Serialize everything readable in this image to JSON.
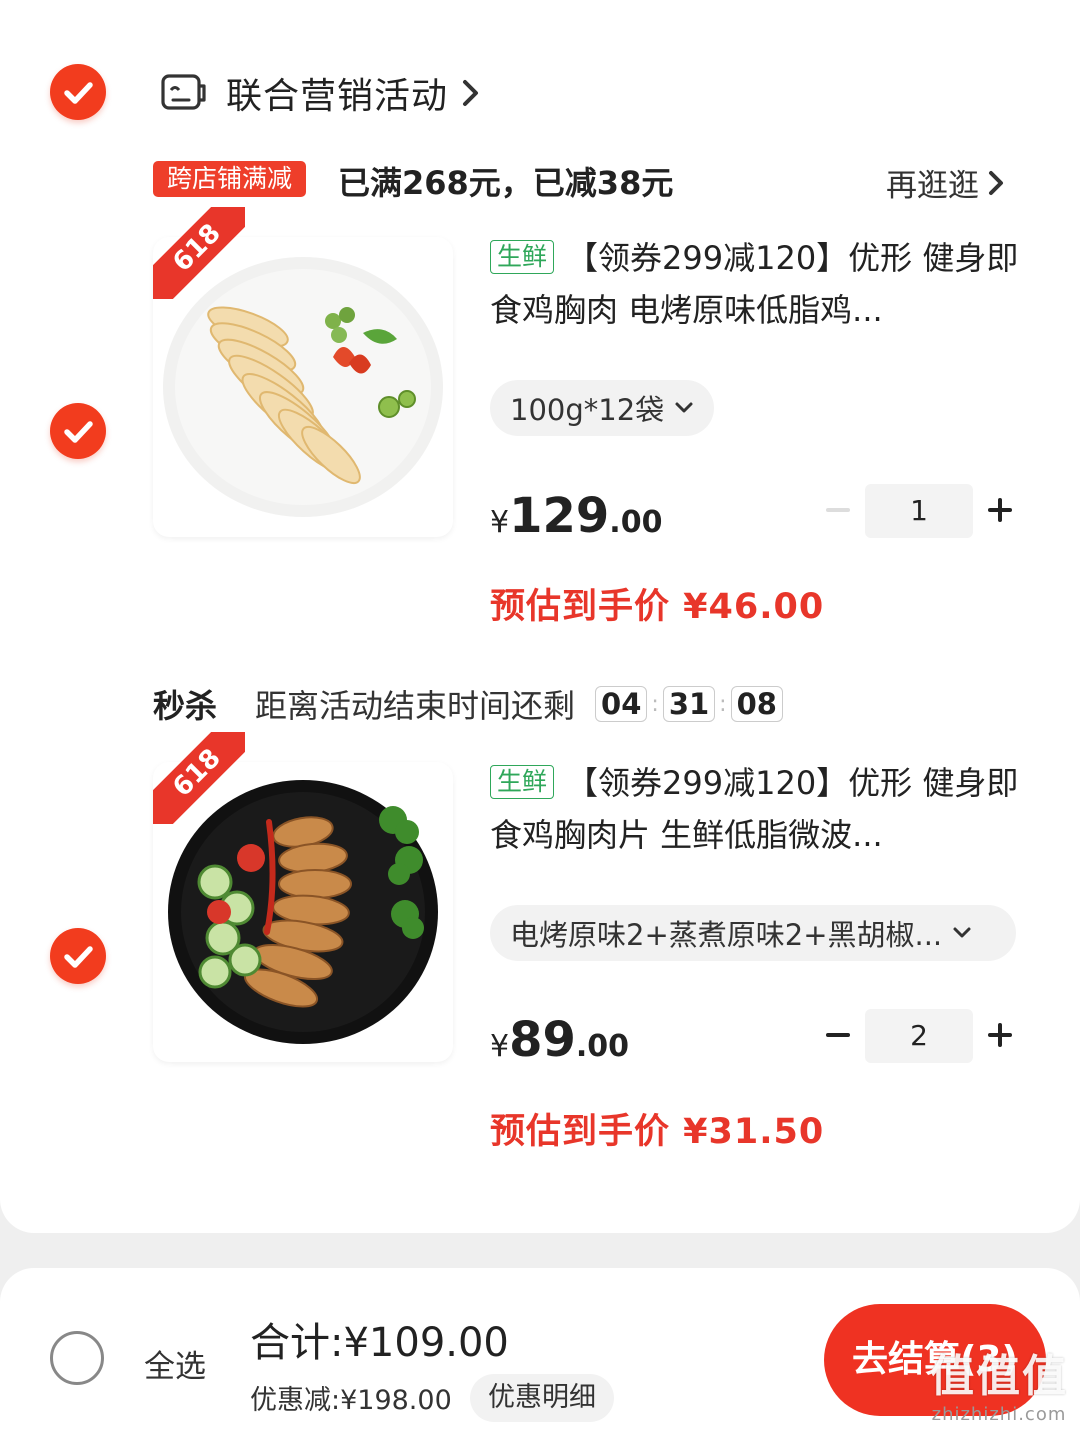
{
  "shop": {
    "name": "联合营销活动",
    "promo_tag": "跨店铺满减",
    "promo_text": "已满268元，已减38元",
    "browse_label": "再逛逛"
  },
  "items": [
    {
      "ribbon": "618",
      "fresh_tag": "生鲜",
      "title": "【领券299减120】优形 健身即食鸡胸肉 电烤原味低脂鸡...",
      "spec": "100g*12袋",
      "price_yen": "¥",
      "price_int": "129",
      "price_dec": ".00",
      "quantity": "1",
      "estimate": "预估到手价 ¥46.00"
    },
    {
      "ribbon": "618",
      "fresh_tag": "生鲜",
      "title": "【领券299减120】优形 健身即食鸡胸肉片 生鲜低脂微波...",
      "spec": "电烤原味2+蒸煮原味2+黑胡椒...",
      "price_yen": "¥",
      "price_int": "89",
      "price_dec": ".00",
      "quantity": "2",
      "estimate": "预估到手价 ¥31.50"
    }
  ],
  "flash": {
    "label": "秒杀",
    "desc": "距离活动结束时间还剩",
    "hours": "04",
    "minutes": "31",
    "seconds": "08"
  },
  "footer": {
    "select_all": "全选",
    "total": "合计:¥109.00",
    "discount": "优惠减:¥198.00",
    "detail_button": "优惠明细",
    "checkout_button": "去结算(3)"
  },
  "watermark": {
    "logo": "值值值",
    "url": "zhizhizhi.com"
  },
  "colors": {
    "accent_red": "#f23c1e",
    "fresh_green": "#2fa75a"
  },
  "icons": [
    "check-icon",
    "shop-icon",
    "chevron-right-icon",
    "chevron-down-icon",
    "minus-icon",
    "plus-icon"
  ]
}
